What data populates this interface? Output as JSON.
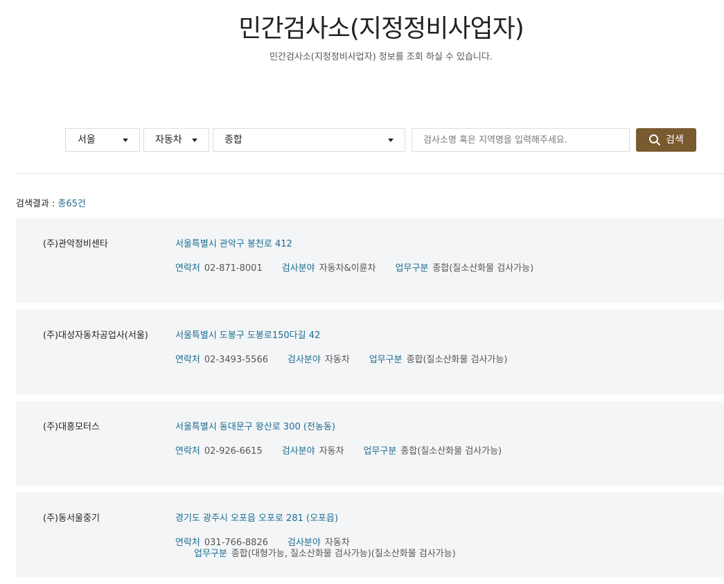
{
  "header": {
    "title": "민간검사소(지정정비사업자)",
    "subtitle": "민간검사소(지정정비사업자) 정보를 조회 하실 수 있습니다."
  },
  "filters": {
    "region": "서울",
    "vehicle_type": "자동차",
    "business_type": "종합"
  },
  "search": {
    "placeholder": "검사소명 혹은 지역명을 입력해주세요.",
    "value": "",
    "button_label": "검색"
  },
  "results": {
    "label": "검색결과 : ",
    "count": "총65건"
  },
  "labels": {
    "contact": "연락처",
    "field": "검사분야",
    "business": "업무구분"
  },
  "items": [
    {
      "name": "(주)관악정비센타",
      "address": "서울특별시 관악구 봉천로 412",
      "contact": "02-871-8001",
      "field": "자동차&이륜차",
      "business": "종합(질소산화물 검사가능)"
    },
    {
      "name": "(주)대성자동차공업사(서울)",
      "address": "서울특별시 도봉구 도봉로150다길 42",
      "contact": "02-3493-5566",
      "field": "자동차",
      "business": "종합(질소산화물 검사가능)"
    },
    {
      "name": "(주)대흥모터스",
      "address": "서울특별시 동대문구 왕산로 300 (전농동)",
      "contact": "02-926-6615",
      "field": "자동차",
      "business": "종합(질소산화물 검사가능)"
    },
    {
      "name": "(주)동서울중기",
      "address": "경기도 광주시 오포읍 오포로 281 (오포읍)",
      "contact": "031-766-8826",
      "field": "자동차",
      "business": "종합(대형가능, 질소산화물 검사가능)(질소산화물 검사가능)"
    }
  ],
  "colors": {
    "accent": "#1a6c8f",
    "button": "#7a5a2f",
    "card_bg": "#f4f5f7"
  }
}
